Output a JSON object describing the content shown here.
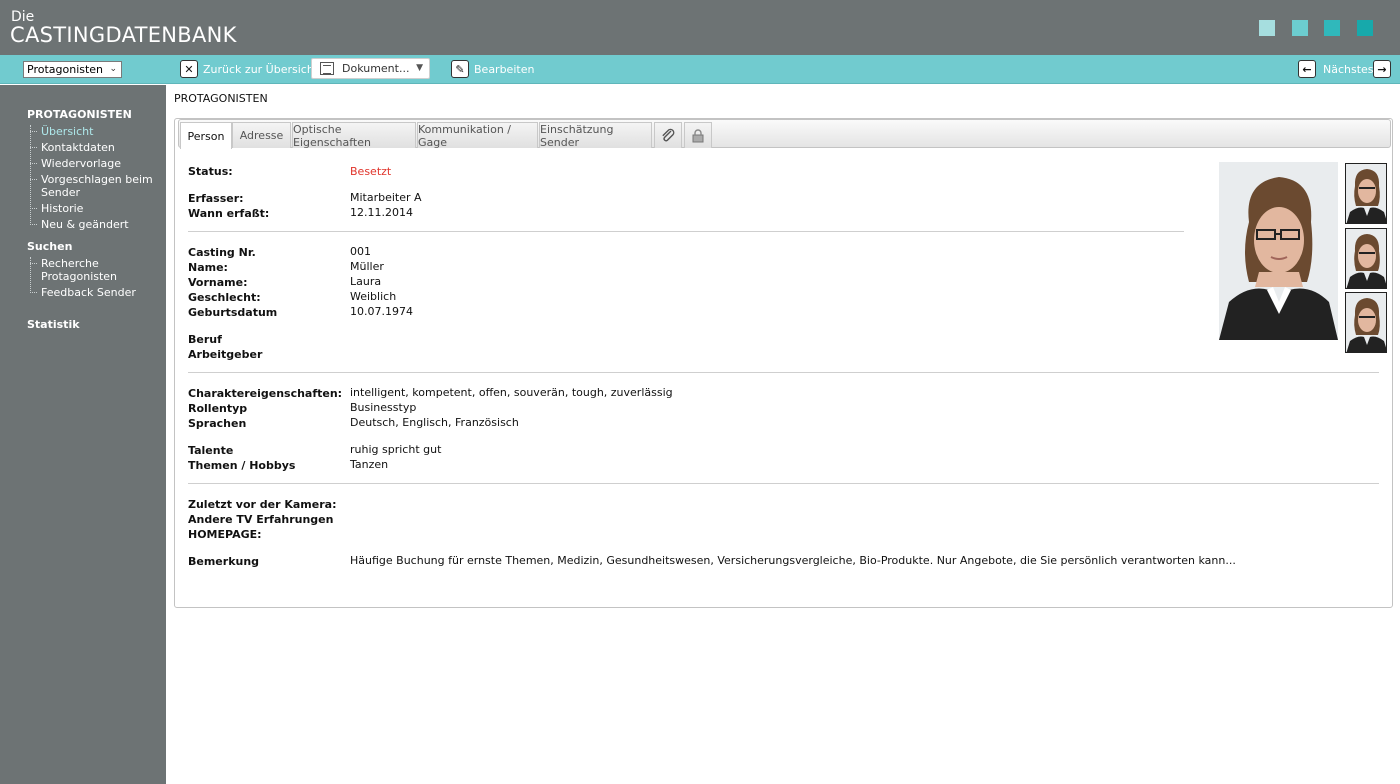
{
  "app": {
    "logo_small": "Die",
    "logo_big": "CASTINGDATENBANK"
  },
  "toolbar": {
    "module_select": "Protagonisten",
    "back_label": "Zurück zur Übersicht",
    "document_select": "Dokument...",
    "edit_label": "Bearbeiten",
    "next_label": "Nächstes"
  },
  "sidebar": {
    "section1": "PROTAGONISTEN",
    "items1": [
      "Übersicht",
      "Kontaktdaten",
      "Wiedervorlage",
      "Vorgeschlagen beim",
      "Sender",
      "Historie",
      "Neu & geändert"
    ],
    "section2": "Suchen",
    "items2": [
      "Recherche",
      "Protagonisten",
      "Feedback Sender"
    ],
    "section3": "Statistik"
  },
  "page_title": "PROTAGONISTEN",
  "tabs": [
    "Person",
    "Adresse",
    "Optische Eigenschaften",
    "Kommunikation / Gage",
    "Einschätzung Sender"
  ],
  "fields": {
    "status": {
      "label": "Status:",
      "value": "Besetzt"
    },
    "erfasser": {
      "label": "Erfasser:",
      "value": "Mitarbeiter A"
    },
    "wann": {
      "label": "Wann erfaßt:",
      "value": "12.11.2014"
    },
    "casting_nr": {
      "label": "Casting Nr.",
      "value": "001"
    },
    "name": {
      "label": "Name:",
      "value": "Müller"
    },
    "vorname": {
      "label": "Vorname:",
      "value": "Laura"
    },
    "geschlecht": {
      "label": "Geschlecht:",
      "value": "Weiblich"
    },
    "geburtsdatum": {
      "label": "Geburtsdatum",
      "value": "10.07.1974"
    },
    "beruf": {
      "label": "Beruf",
      "value": ""
    },
    "arbeitgeber": {
      "label": "Arbeitgeber",
      "value": ""
    },
    "charakter": {
      "label": "Charaktereigenschaften:",
      "value": "intelligent, kompetent, offen, souverän, tough, zuverlässig"
    },
    "rollentyp": {
      "label": "Rollentyp",
      "value": "Businesstyp"
    },
    "sprachen": {
      "label": "Sprachen",
      "value": "Deutsch, Englisch, Französisch"
    },
    "talente": {
      "label": "Talente",
      "value": "ruhig spricht gut"
    },
    "themen": {
      "label": "Themen / Hobbys",
      "value": "Tanzen"
    },
    "zuletzt": {
      "label": "Zuletzt vor der Kamera:",
      "value": ""
    },
    "andere_tv": {
      "label": "Andere TV Erfahrungen",
      "value": ""
    },
    "homepage": {
      "label": "HOMEPAGE:",
      "value": ""
    },
    "bemerkung": {
      "label": "Bemerkung",
      "value": "Häufige Buchung für ernste Themen, Medizin, Gesundheitswesen, Versicherungsvergleiche, Bio-Produkte. Nur Angebote, die Sie persönlich verantworten kann..."
    }
  },
  "colors": {
    "header_gray": "#6d7374",
    "toolbar_teal": "#71cbcf",
    "status_red": "#e0332a",
    "active_link": "#aee8eb"
  }
}
